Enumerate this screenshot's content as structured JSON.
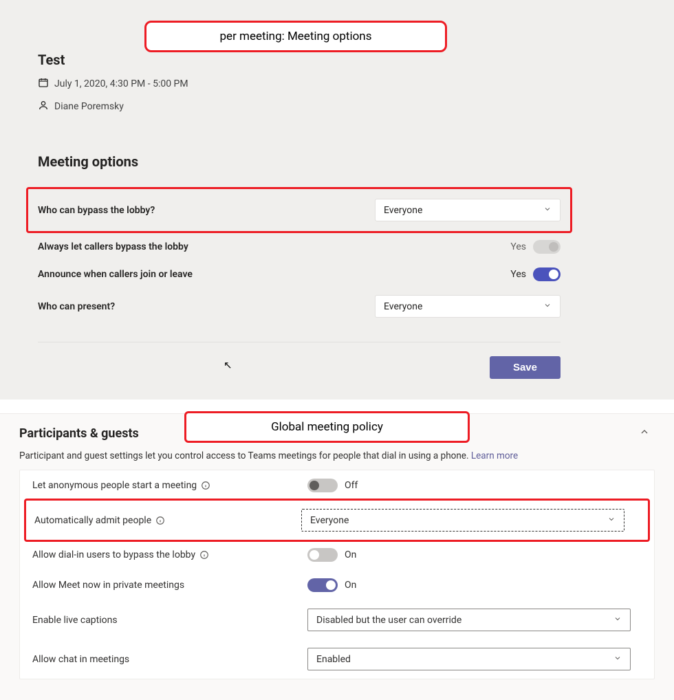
{
  "annotations": {
    "top": "per meeting: Meeting options",
    "bottom": "Global meeting policy"
  },
  "meeting": {
    "title": "Test",
    "datetime": "July 1, 2020, 4:30 PM - 5:00 PM",
    "organizer": "Diane Poremsky"
  },
  "meeting_options": {
    "heading": "Meeting options",
    "rows": {
      "bypass_lobby": {
        "label": "Who can bypass the lobby?",
        "value": "Everyone"
      },
      "callers_bypass": {
        "label": "Always let callers bypass the lobby",
        "state": "Yes",
        "enabled": false
      },
      "announce": {
        "label": "Announce when callers join or leave",
        "state": "Yes",
        "enabled": true
      },
      "who_present": {
        "label": "Who can present?",
        "value": "Everyone"
      }
    },
    "save": "Save"
  },
  "policy": {
    "heading": "Participants & guests",
    "description": "Participant and guest settings let you control access to Teams meetings for people that dial in using a phone. ",
    "learn_more": "Learn more",
    "rows": {
      "anon_start": {
        "label": "Let anonymous people start a meeting",
        "state": "Off"
      },
      "auto_admit": {
        "label": "Automatically admit people",
        "value": "Everyone"
      },
      "dialin_bypass": {
        "label": "Allow dial-in users to bypass the lobby",
        "state": "On"
      },
      "meet_now": {
        "label": "Allow Meet now in private meetings",
        "state": "On"
      },
      "live_captions": {
        "label": "Enable live captions",
        "value": "Disabled but the user can override"
      },
      "chat": {
        "label": "Allow chat in meetings",
        "value": "Enabled"
      }
    }
  }
}
